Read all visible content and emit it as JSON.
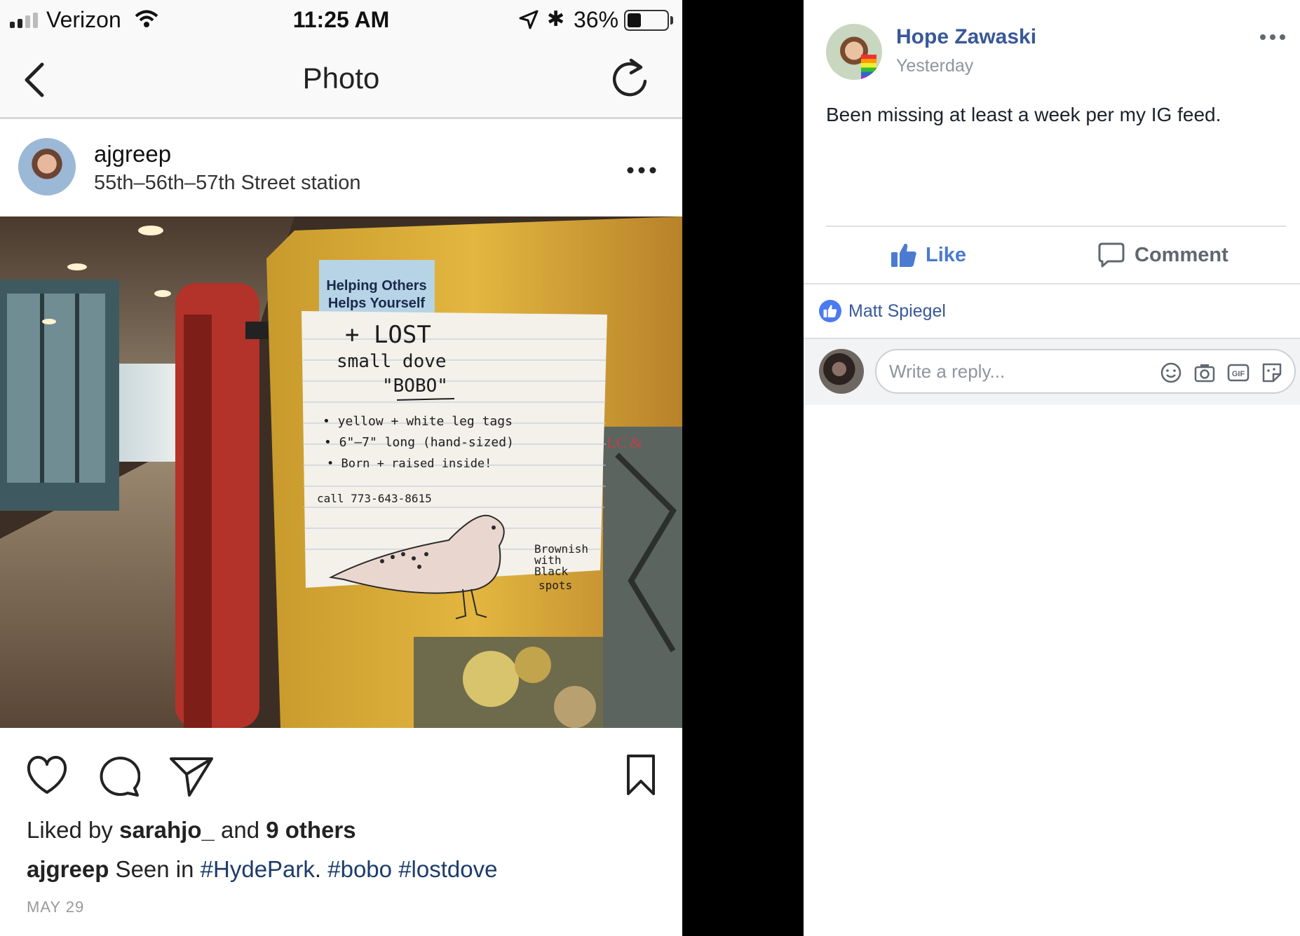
{
  "instagram": {
    "status_bar": {
      "carrier": "Verizon",
      "time": "11:25 AM",
      "battery_percent": "36%",
      "battery_level": 0.36,
      "signal_bars_filled": 2,
      "signal_bars_total": 4
    },
    "nav": {
      "title": "Photo"
    },
    "post": {
      "username": "ajgreep",
      "location": "55th–56th–57th Street station",
      "likes": {
        "prefix": "Liked by ",
        "user": "sarahjo_",
        "middle": " and ",
        "others": "9 others"
      },
      "caption": {
        "user": "ajgreep",
        "text": " Seen in ",
        "tags": [
          "#HydePark",
          ". ",
          "#bobo",
          " ",
          "#lostdove"
        ]
      },
      "date": "MAY 29"
    },
    "photo": {
      "sticker": [
        "Helping Others",
        "Helps Yourself"
      ],
      "note_lines": [
        "+ LOST",
        "small      dove",
        "\"BOBO\"",
        "• yellow + white leg tags",
        "• 6\"–7\" long (hand-sized)",
        "• Born + raised inside!",
        "call 773-643-8615"
      ],
      "note_side": [
        "Brownish",
        "with",
        "Black",
        "spots"
      ],
      "edge_text": "LC &"
    }
  },
  "facebook": {
    "comment": {
      "author": "Hope Zawaski",
      "time": "Yesterday",
      "text": "Been missing at least a week per my IG feed."
    },
    "actions": {
      "like": "Like",
      "comment": "Comment"
    },
    "liked_by": "Matt Spiegel",
    "reply": {
      "placeholder": "Write a reply..."
    },
    "reply_icons": [
      "emoji-icon",
      "camera-icon",
      "gif-icon",
      "sticker-icon"
    ]
  },
  "colors": {
    "fb_link": "#385898",
    "fb_like_blue": "#4b7bd0",
    "ig_hashtag": "#1c3c6b"
  }
}
